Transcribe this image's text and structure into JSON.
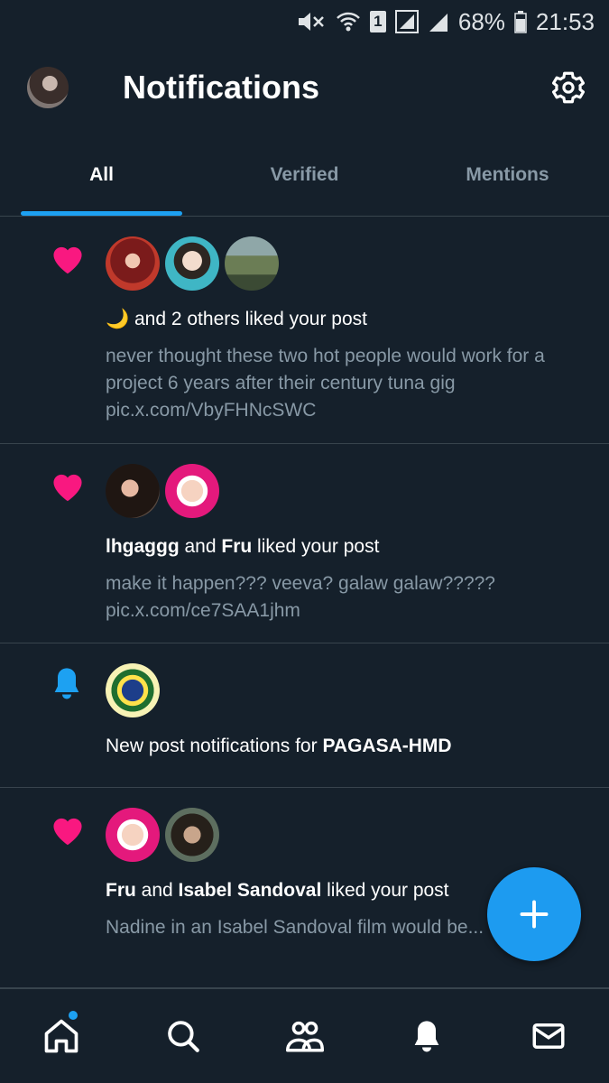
{
  "status_bar": {
    "battery": "68%",
    "time": "21:53",
    "sim": "1"
  },
  "header": {
    "title": "Notifications"
  },
  "tabs": [
    {
      "label": "All",
      "active": true
    },
    {
      "label": "Verified",
      "active": false
    },
    {
      "label": "Mentions",
      "active": false
    }
  ],
  "notifications": [
    {
      "type": "like",
      "icon": "heart-icon",
      "actor": "🌙",
      "action": " and 2 others liked your post",
      "snippet": "never thought these two hot people would work for a project 6 years after their century tuna gig pic.x.com/VbyFHNcSWC"
    },
    {
      "type": "like",
      "icon": "heart-icon",
      "actor1": "lhgaggg",
      "joiner": " and ",
      "actor2": "Fru",
      "action": " liked your post",
      "snippet": "make it happen??? veeva? galaw galaw????? pic.x.com/ce7SAA1jhm"
    },
    {
      "type": "subscription",
      "icon": "bell-icon",
      "prefix": "New post notifications for ",
      "account": "PAGASA-HMD"
    },
    {
      "type": "like",
      "icon": "heart-icon",
      "actor1": "Fru",
      "joiner": " and ",
      "actor2": "Isabel Sandoval",
      "action": " liked your post",
      "snippet": "Nadine in an Isabel Sandoval film would be..."
    }
  ],
  "colors": {
    "background": "#15202b",
    "accent": "#1da1f2",
    "heart": "#f91880",
    "muted_text": "#8899a6",
    "divider": "#38444d"
  },
  "bottom_nav": [
    {
      "icon": "home-icon",
      "has_badge": true
    },
    {
      "icon": "search-icon",
      "has_badge": false
    },
    {
      "icon": "communities-icon",
      "has_badge": false
    },
    {
      "icon": "bell-icon",
      "has_badge": false,
      "active": true
    },
    {
      "icon": "mail-icon",
      "has_badge": false
    }
  ]
}
